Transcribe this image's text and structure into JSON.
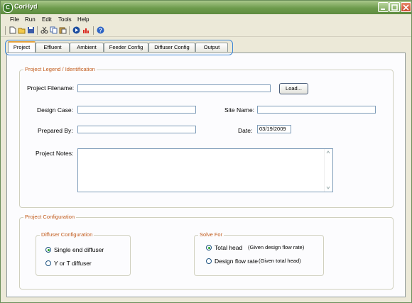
{
  "window": {
    "title": "CorHyd",
    "app_icon_letter": "C"
  },
  "menu": [
    "File",
    "Run",
    "Edit",
    "Tools",
    "Help"
  ],
  "toolbar_icons": [
    "new-file-icon",
    "open-folder-icon",
    "save-icon",
    "cut-icon",
    "copy-icon",
    "paste-icon",
    "run-icon",
    "chart-icon",
    "help-icon"
  ],
  "tabs": [
    "Project",
    "Effluent",
    "Ambient",
    "Feeder Config",
    "Diffuser Config",
    "Output"
  ],
  "active_tab": "Project",
  "legend_group": {
    "title": "Project Legend / Identification",
    "filename_label": "Project Filename:",
    "filename_value": "",
    "load_button": "Load...",
    "design_case_label": "Design Case:",
    "design_case_value": "",
    "site_name_label": "Site Name:",
    "site_name_value": "",
    "prepared_by_label": "Prepared By:",
    "prepared_by_value": "",
    "date_label": "Date:",
    "date_value": "03/19/2009",
    "notes_label": "Project Notes:",
    "notes_value": ""
  },
  "config_group": {
    "title": "Project Configuration",
    "diffuser": {
      "title": "Diffuser Configuration",
      "options": [
        {
          "label": "Single end diffuser",
          "checked": true
        },
        {
          "label": "Y or T diffuser",
          "checked": false
        }
      ]
    },
    "solve": {
      "title": "Solve For",
      "options": [
        {
          "label": "Total head",
          "note": "(Given design flow rate)",
          "checked": true
        },
        {
          "label": "Design flow rate",
          "note": "(Given total head)",
          "checked": false
        }
      ]
    }
  },
  "colors": {
    "title_bar": "#6d9b4c",
    "legend_text": "#c15a1a",
    "tab_highlight": "#3f87d6",
    "radio_dot": "#21a121"
  }
}
